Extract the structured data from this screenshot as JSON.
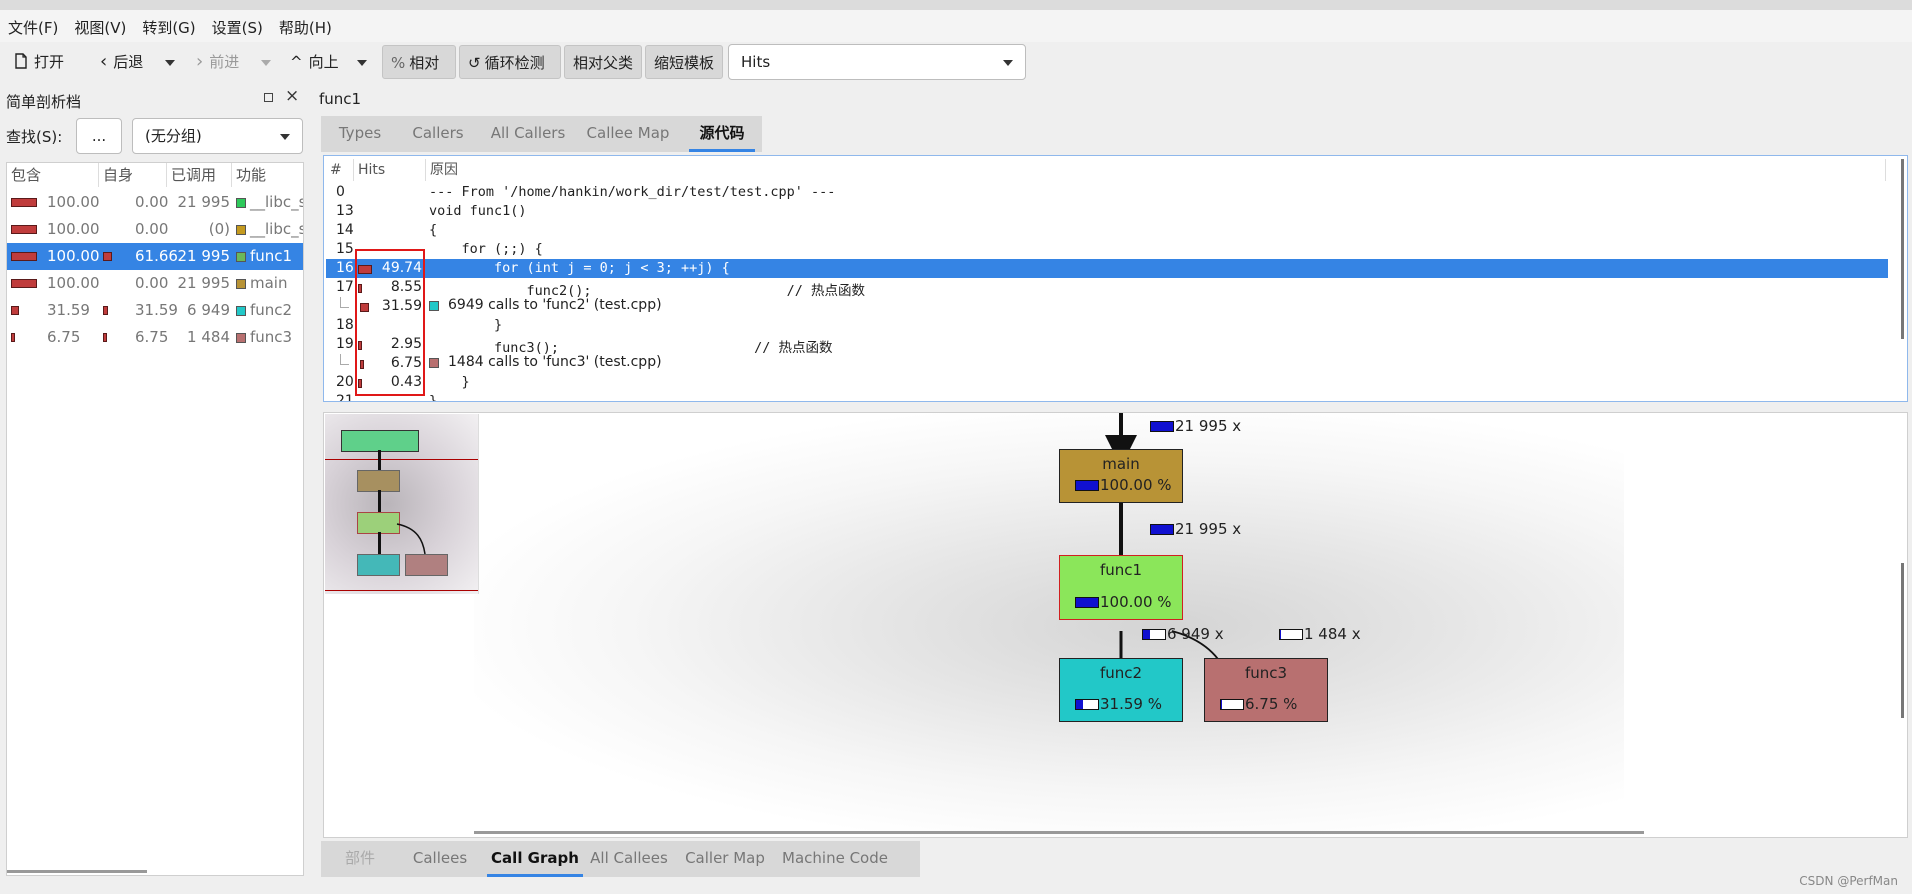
{
  "menu": [
    "文件(F)",
    "视图(V)",
    "转到(G)",
    "设置(S)",
    "帮助(H)"
  ],
  "toolbar": {
    "open": "打开",
    "back": "后退",
    "forward": "前进",
    "up": "向上",
    "relative": "相对",
    "cycle": "循环检测",
    "relative_parent": "相对父类",
    "shorten": "缩短模板",
    "event_type": "Hits"
  },
  "left_panel": {
    "title": "简单剖析档",
    "search_label": "查找(S):",
    "search_value": "...",
    "group_value": "(无分组)",
    "columns": [
      "包含",
      "自身",
      "已调用",
      "功能"
    ],
    "rows": [
      {
        "incl": "100.00",
        "self": "0.00",
        "called": "21 995",
        "name": "__libc_s",
        "color": "#2ec95b",
        "incl_frac": 1.0,
        "self_frac": 0.0
      },
      {
        "incl": "100.00",
        "self": "0.00",
        "called": "(0)",
        "name": "__libc_s",
        "color": "#c49a1f",
        "incl_frac": 1.0,
        "self_frac": 0.0
      },
      {
        "incl": "100.00",
        "self": "61.66",
        "called": "21 995",
        "name": "func1",
        "color": "#6ab85a",
        "incl_frac": 1.0,
        "self_frac": 0.6166,
        "selected": true
      },
      {
        "incl": "100.00",
        "self": "0.00",
        "called": "21 995",
        "name": "main",
        "color": "#b89336",
        "incl_frac": 1.0,
        "self_frac": 0.0
      },
      {
        "incl": "31.59",
        "self": "31.59",
        "called": "6 949",
        "name": "func2",
        "color": "#22c8c8",
        "incl_frac": 0.3159,
        "self_frac": 0.3159
      },
      {
        "incl": "6.75",
        "self": "6.75",
        "called": "1 484",
        "name": "func3",
        "color": "#b87070",
        "incl_frac": 0.0675,
        "self_frac": 0.0675
      }
    ]
  },
  "function_title": "func1",
  "top_tabs": [
    "Types",
    "Callers",
    "All Callers",
    "Callee Map",
    "源代码"
  ],
  "source": {
    "columns": [
      "#",
      "Hits",
      "原因"
    ],
    "rows": [
      {
        "ln": "0",
        "hits": "",
        "code": "--- From '/home/hankin/work_dir/test/test.cpp' ---"
      },
      {
        "ln": "13",
        "hits": "",
        "code": "void func1()"
      },
      {
        "ln": "14",
        "hits": "",
        "code": "{"
      },
      {
        "ln": "15",
        "hits": "",
        "code": "    for (;;) {"
      },
      {
        "ln": "16",
        "hits": "49.74",
        "code": "        for (int j = 0; j < 3; ++j) {",
        "selected": true
      },
      {
        "ln": "17",
        "hits": "8.55",
        "code": "            func2();                        // 热点函数"
      },
      {
        "ln": "",
        "hits": "31.59",
        "call": "6949 calls to 'func2' (test.cpp)",
        "color": "#22c8c8"
      },
      {
        "ln": "18",
        "hits": "",
        "code": "        }"
      },
      {
        "ln": "19",
        "hits": "2.95",
        "code": "        func3();                        // 热点函数"
      },
      {
        "ln": "",
        "hits": "6.75",
        "call": "1484 calls to 'func3' (test.cpp)",
        "color": "#b87070"
      },
      {
        "ln": "20",
        "hits": "0.43",
        "code": "    }"
      },
      {
        "ln": "21",
        "hits": "",
        "code": "}"
      }
    ]
  },
  "graph": {
    "nodes": [
      {
        "name": "main",
        "pct": "100.00 %",
        "frac": 1.0,
        "color": "#b89336"
      },
      {
        "name": "func1",
        "pct": "100.00 %",
        "frac": 1.0,
        "color": "#8be65a"
      },
      {
        "name": "func2",
        "pct": "31.59 %",
        "frac": 0.3159,
        "color": "#22c8c8"
      },
      {
        "name": "func3",
        "pct": "6.75 %",
        "frac": 0.0675,
        "color": "#b87070"
      }
    ],
    "edges": [
      {
        "label": "21 995 x",
        "frac": 1.0
      },
      {
        "label": "21 995 x",
        "frac": 1.0
      },
      {
        "label": "6 949 x",
        "frac": 0.3159
      },
      {
        "label": "1 484 x",
        "frac": 0.0675
      }
    ]
  },
  "bottom_tabs": [
    "部件",
    "Callees",
    "Call Graph",
    "All Callees",
    "Caller Map",
    "Machine Code"
  ],
  "watermark": "CSDN @PerfMan"
}
